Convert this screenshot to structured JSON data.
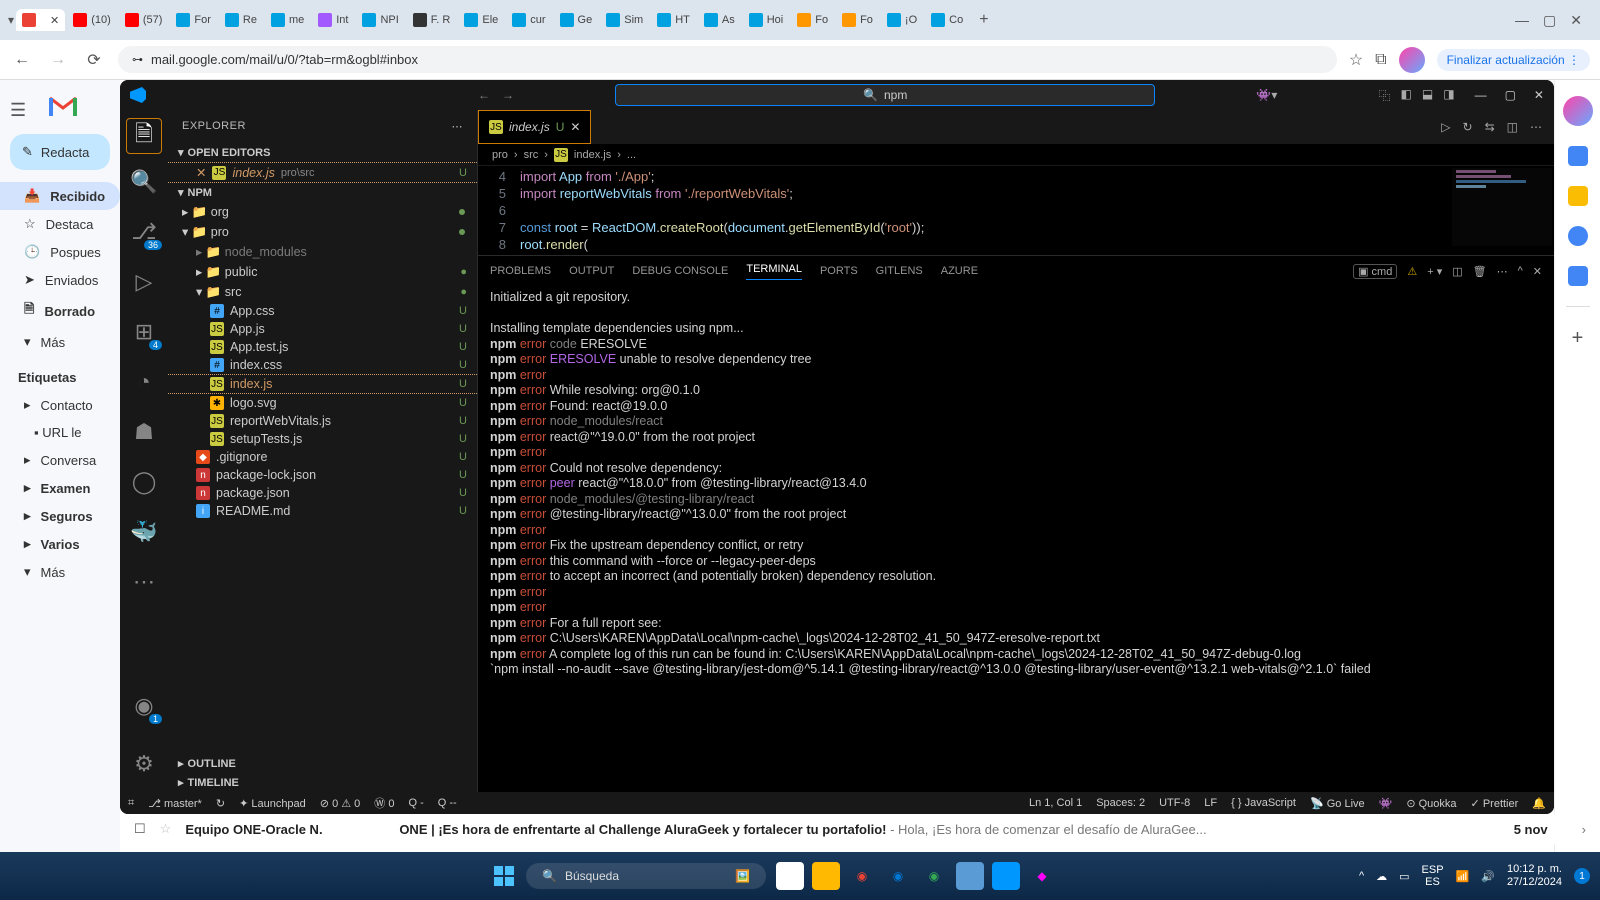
{
  "browser": {
    "tabs": [
      {
        "label": "",
        "color": "#ea4335"
      },
      {
        "label": "(10)",
        "color": "#f00"
      },
      {
        "label": "(57)",
        "color": "#f00"
      },
      {
        "label": "For",
        "color": "#00a1e0"
      },
      {
        "label": "Re",
        "color": "#00a1e0"
      },
      {
        "label": "me",
        "color": "#00a1e0"
      },
      {
        "label": "Int",
        "color": "#a259ff"
      },
      {
        "label": "NPI",
        "color": "#00a1e0"
      },
      {
        "label": "F. R",
        "color": "#333"
      },
      {
        "label": "Ele",
        "color": "#00a1e0"
      },
      {
        "label": "cur",
        "color": "#00a1e0"
      },
      {
        "label": "Ge",
        "color": "#00a1e0"
      },
      {
        "label": "Sim",
        "color": "#00a1e0"
      },
      {
        "label": "HT",
        "color": "#00a1e0"
      },
      {
        "label": "As",
        "color": "#00a1e0"
      },
      {
        "label": "Hoi",
        "color": "#00a1e0"
      },
      {
        "label": "Fo",
        "color": "#ff9800"
      },
      {
        "label": "Fo",
        "color": "#ff9800"
      },
      {
        "label": "¡O",
        "color": "#00a1e0"
      },
      {
        "label": "Co",
        "color": "#00a1e0"
      }
    ],
    "url": "mail.google.com/mail/u/0/?tab=rm&ogbl#inbox",
    "update": "Finalizar actualización"
  },
  "gmail": {
    "compose": "Redacta",
    "items": [
      "Recibido",
      "Destaca",
      "Pospues",
      "Enviados",
      "Borrado",
      "Más"
    ],
    "labels_title": "Etiquetas",
    "labels": [
      "Contacto",
      "URL le",
      "Conversa",
      "Examen",
      "Seguros",
      "Varios",
      "Más"
    ],
    "email_sender": "Equipo ONE-Oracle N.",
    "email_subject": "ONE | ¡Es hora de enfrentarte al Challenge AluraGeek y fortalecer tu portafolio!",
    "email_preview": " - Hola, ¡Es hora de comenzar el desafío de AluraGee...",
    "email_date": "5 nov"
  },
  "vscode": {
    "search": "npm",
    "explorer_title": "EXPLORER",
    "sections": {
      "open_editors": "OPEN EDITORS",
      "npm": "NPM",
      "outline": "OUTLINE",
      "timeline": "TIMELINE"
    },
    "open_editor": {
      "file": "index.js",
      "path": "pro\\src",
      "status": "U"
    },
    "tree": {
      "org": "org",
      "pro": "pro",
      "node_modules": "node_modules",
      "public": "public",
      "src": "src",
      "files": [
        {
          "name": "App.css",
          "icon": "css",
          "s": "U"
        },
        {
          "name": "App.js",
          "icon": "js",
          "s": "U"
        },
        {
          "name": "App.test.js",
          "icon": "js",
          "s": "U"
        },
        {
          "name": "index.css",
          "icon": "css",
          "s": "U"
        },
        {
          "name": "index.js",
          "icon": "js",
          "s": "U",
          "sel": true
        },
        {
          "name": "logo.svg",
          "icon": "svg",
          "s": "U"
        },
        {
          "name": "reportWebVitals.js",
          "icon": "js",
          "s": "U"
        },
        {
          "name": "setupTests.js",
          "icon": "js",
          "s": "U"
        }
      ],
      "root_files": [
        {
          "name": ".gitignore",
          "icon": "git",
          "s": "U"
        },
        {
          "name": "package-lock.json",
          "icon": "npm",
          "s": "U"
        },
        {
          "name": "package.json",
          "icon": "npm",
          "s": "U"
        },
        {
          "name": "README.md",
          "icon": "md",
          "s": "U"
        }
      ]
    },
    "tab": {
      "file": "index.js",
      "status": "U"
    },
    "breadcrumb": [
      "pro",
      "src",
      "index.js",
      "..."
    ],
    "code": [
      {
        "n": 4,
        "html": "<span class='tk-key'>import</span> <span class='tk-id'>App</span> <span class='tk-key'>from</span> <span class='tk-str'>'./App'</span><span class='tk-pun'>;</span>"
      },
      {
        "n": 5,
        "html": "<span class='tk-key'>import</span> <span class='tk-id'>reportWebVitals</span> <span class='tk-key'>from</span> <span class='tk-str'>'./reportWebVitals'</span><span class='tk-pun'>;</span>"
      },
      {
        "n": 6,
        "html": ""
      },
      {
        "n": 7,
        "html": "<span class='tk-kw2'>const</span> <span class='tk-id'>root</span> <span class='tk-pun'>=</span> <span class='tk-id'>ReactDOM</span><span class='tk-pun'>.</span><span class='tk-fn'>createRoot</span><span class='tk-pun'>(</span><span class='tk-id'>document</span><span class='tk-pun'>.</span><span class='tk-fn'>getElementById</span><span class='tk-pun'>(</span><span class='tk-str'>'root'</span><span class='tk-pun'>));</span>"
      },
      {
        "n": 8,
        "html": "<span class='tk-id'>root</span><span class='tk-pun'>.</span><span class='tk-fn'>render</span><span class='tk-pun'>(</span>"
      }
    ],
    "panel_tabs": [
      "PROBLEMS",
      "OUTPUT",
      "DEBUG CONSOLE",
      "TERMINAL",
      "PORTS",
      "GITLENS",
      "AZURE"
    ],
    "panel_active": 3,
    "term_shell": "cmd",
    "terminal": [
      [
        {
          "t": "Initialized a git repository.",
          "c": ""
        }
      ],
      [],
      [
        {
          "t": "Installing template dependencies using npm...",
          "c": ""
        }
      ],
      [
        {
          "t": "npm ",
          "c": "e-npm"
        },
        {
          "t": "error ",
          "c": "e-err"
        },
        {
          "t": "code",
          "c": "e-dim"
        },
        {
          "t": " ERESOLVE",
          "c": ""
        }
      ],
      [
        {
          "t": "npm ",
          "c": "e-npm"
        },
        {
          "t": "error ",
          "c": "e-err"
        },
        {
          "t": "ERESOLVE",
          "c": "e-mag"
        },
        {
          "t": " unable to resolve dependency tree",
          "c": ""
        }
      ],
      [
        {
          "t": "npm ",
          "c": "e-npm"
        },
        {
          "t": "error",
          "c": "e-err"
        }
      ],
      [
        {
          "t": "npm ",
          "c": "e-npm"
        },
        {
          "t": "error ",
          "c": "e-err"
        },
        {
          "t": "While resolving: org@0.1.0",
          "c": ""
        }
      ],
      [
        {
          "t": "npm ",
          "c": "e-npm"
        },
        {
          "t": "error ",
          "c": "e-err"
        },
        {
          "t": "Found: react@19.0.0",
          "c": ""
        }
      ],
      [
        {
          "t": "npm ",
          "c": "e-npm"
        },
        {
          "t": "error ",
          "c": "e-err"
        },
        {
          "t": "node_modules/react",
          "c": "e-dim"
        }
      ],
      [
        {
          "t": "npm ",
          "c": "e-npm"
        },
        {
          "t": "error   ",
          "c": "e-err"
        },
        {
          "t": "react@\"^19.0.0\" from the root project",
          "c": ""
        }
      ],
      [
        {
          "t": "npm ",
          "c": "e-npm"
        },
        {
          "t": "error",
          "c": "e-err"
        }
      ],
      [
        {
          "t": "npm ",
          "c": "e-npm"
        },
        {
          "t": "error ",
          "c": "e-err"
        },
        {
          "t": "Could not resolve dependency:",
          "c": ""
        }
      ],
      [
        {
          "t": "npm ",
          "c": "e-npm"
        },
        {
          "t": "error ",
          "c": "e-err"
        },
        {
          "t": "peer",
          "c": "e-mag"
        },
        {
          "t": " react@\"^18.0.0\" from @testing-library/react@13.4.0",
          "c": ""
        }
      ],
      [
        {
          "t": "npm ",
          "c": "e-npm"
        },
        {
          "t": "error ",
          "c": "e-err"
        },
        {
          "t": "node_modules/@testing-library/react",
          "c": "e-dim"
        }
      ],
      [
        {
          "t": "npm ",
          "c": "e-npm"
        },
        {
          "t": "error   ",
          "c": "e-err"
        },
        {
          "t": "@testing-library/react@\"^13.0.0\" from the root project",
          "c": ""
        }
      ],
      [
        {
          "t": "npm ",
          "c": "e-npm"
        },
        {
          "t": "error",
          "c": "e-err"
        }
      ],
      [
        {
          "t": "npm ",
          "c": "e-npm"
        },
        {
          "t": "error ",
          "c": "e-err"
        },
        {
          "t": "Fix the upstream dependency conflict, or retry",
          "c": ""
        }
      ],
      [
        {
          "t": "npm ",
          "c": "e-npm"
        },
        {
          "t": "error ",
          "c": "e-err"
        },
        {
          "t": "this command with --force or --legacy-peer-deps",
          "c": ""
        }
      ],
      [
        {
          "t": "npm ",
          "c": "e-npm"
        },
        {
          "t": "error ",
          "c": "e-err"
        },
        {
          "t": "to accept an incorrect (and potentially broken) dependency resolution.",
          "c": ""
        }
      ],
      [
        {
          "t": "npm ",
          "c": "e-npm"
        },
        {
          "t": "error",
          "c": "e-err"
        }
      ],
      [
        {
          "t": "npm ",
          "c": "e-npm"
        },
        {
          "t": "error",
          "c": "e-err"
        }
      ],
      [
        {
          "t": "npm ",
          "c": "e-npm"
        },
        {
          "t": "error ",
          "c": "e-err"
        },
        {
          "t": "For a full report see:",
          "c": ""
        }
      ],
      [
        {
          "t": "npm ",
          "c": "e-npm"
        },
        {
          "t": "error ",
          "c": "e-err"
        },
        {
          "t": "C:\\Users\\KAREN\\AppData\\Local\\npm-cache\\_logs\\2024-12-28T02_41_50_947Z-eresolve-report.txt",
          "c": ""
        }
      ],
      [
        {
          "t": "npm ",
          "c": "e-npm"
        },
        {
          "t": "error ",
          "c": "e-err"
        },
        {
          "t": "A complete log of this run can be found in: C:\\Users\\KAREN\\AppData\\Local\\npm-cache\\_logs\\2024-12-28T02_41_50_947Z-debug-0.log",
          "c": ""
        }
      ],
      [
        {
          "t": "`npm install --no-audit --save @testing-library/jest-dom@^5.14.1 @testing-library/react@^13.0.0 @testing-library/user-event@^13.2.1 web-vitals@^2.1.0` failed",
          "c": ""
        }
      ]
    ],
    "status": {
      "branch": "master*",
      "sync": "↻",
      "launchpad": "Launchpad",
      "errors": "⊘ 0 ⚠ 0",
      "w0": "Ⓦ 0",
      "q": [
        "Q -",
        "Q --"
      ],
      "pos": "Ln 1, Col 1",
      "spaces": "Spaces: 2",
      "enc": "UTF-8",
      "eol": "LF",
      "lang": "JavaScript",
      "golive": "Go Live",
      "quokka": "Quokka",
      "prettier": "Prettier"
    }
  },
  "taskbar": {
    "search": "Búsqueda",
    "lang1": "ESP",
    "lang2": "ES",
    "time": "10:12 p. m.",
    "date": "27/12/2024"
  }
}
